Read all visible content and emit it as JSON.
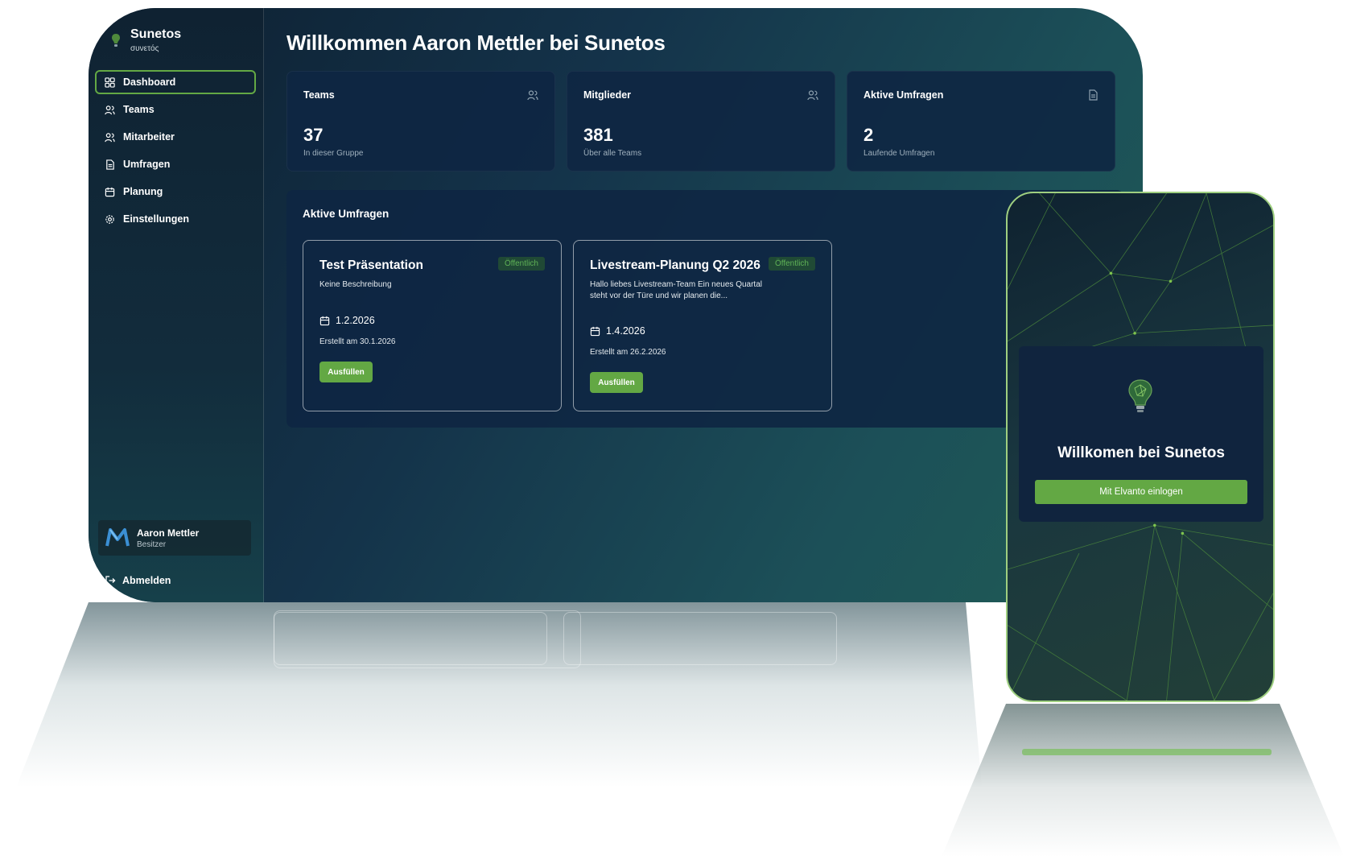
{
  "brand": {
    "name": "Sunetos",
    "subtitle": "συνετός"
  },
  "sidebar": {
    "items": [
      {
        "label": "Dashboard",
        "icon": "dashboard-icon",
        "active": true
      },
      {
        "label": "Teams",
        "icon": "users-icon",
        "active": false
      },
      {
        "label": "Mitarbeiter",
        "icon": "users-icon",
        "active": false
      },
      {
        "label": "Umfragen",
        "icon": "document-icon",
        "active": false
      },
      {
        "label": "Planung",
        "icon": "calendar-icon",
        "active": false
      },
      {
        "label": "Einstellungen",
        "icon": "gear-icon",
        "active": false
      }
    ],
    "user": {
      "name": "Aaron Mettler",
      "role": "Besitzer"
    },
    "logout_label": "Abmelden"
  },
  "main": {
    "title": "Willkommen Aaron Mettler bei Sunetos",
    "stats": [
      {
        "label": "Teams",
        "value": "37",
        "sub": "In dieser Gruppe",
        "icon": "users-icon"
      },
      {
        "label": "Mitglieder",
        "value": "381",
        "sub": "Über alle Teams",
        "icon": "users-icon"
      },
      {
        "label": "Aktive Umfragen",
        "value": "2",
        "sub": "Laufende Umfragen",
        "icon": "document-icon"
      }
    ],
    "surveys_title": "Aktive Umfragen",
    "surveys": [
      {
        "title": "Test Präsentation",
        "badge": "Öffentlich",
        "description": "Keine Beschreibung",
        "date": "1.2.2026",
        "created": "Erstellt am 30.1.2026",
        "button": "Ausfüllen"
      },
      {
        "title": "Livestream-Planung Q2 2026",
        "badge": "Öffentlich",
        "description": "Hallo liebes Livestream-Team Ein neues Quartal steht vor der Türe und wir planen die...",
        "date": "1.4.2026",
        "created": "Erstellt am 26.2.2026",
        "button": "Ausfüllen"
      }
    ]
  },
  "phone": {
    "title": "Willkomen bei Sunetos",
    "button": "Mit Elvanto einlogen"
  },
  "colors": {
    "accent": "#63a844",
    "panel": "#0e2642",
    "badge_text": "#5fb256"
  }
}
